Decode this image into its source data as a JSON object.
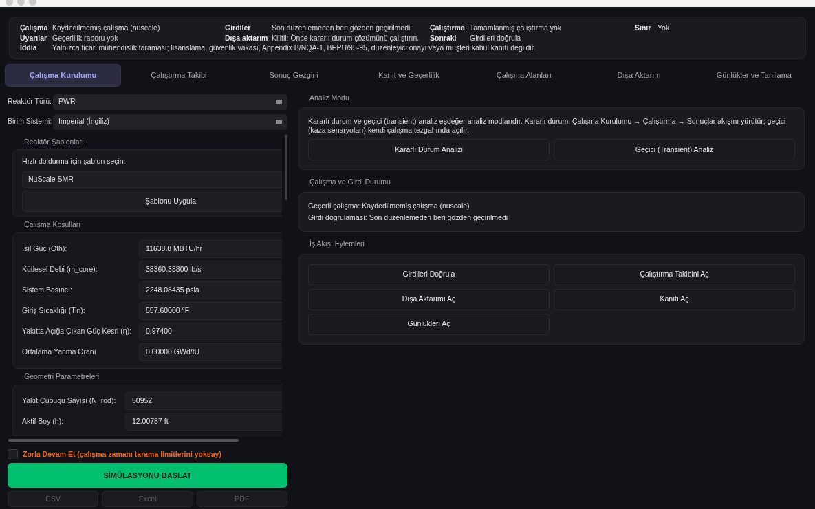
{
  "status": {
    "rows": [
      [
        {
          "label": "Çalışma",
          "value": "Kaydedilmemiş çalışma (nuscale)"
        },
        {
          "label": "Girdiler",
          "value": "Son düzenlemeden beri gözden geçirilmedi"
        },
        {
          "label": "Çalıştırma",
          "value": "Tamamlanmış çalıştırma yok"
        },
        {
          "label": "Sınır",
          "value": "Yok"
        }
      ],
      [
        {
          "label": "Uyarılar",
          "value": "Geçerlilik raporu yok"
        },
        {
          "label": "Dışa aktarım",
          "value": "Kilitli: Önce kararlı durum çözümünü çalıştırın."
        },
        {
          "label": "Sonraki",
          "value": "Girdileri doğrula"
        }
      ],
      [
        {
          "label": "İddia",
          "value": "Yalnızca ticari mühendislik taraması; lisanslama, güvenlik vakası, Appendix B/NQA-1, BEPU/95-95, düzenleyici onayı veya müşteri kabul kanıtı değildir."
        }
      ]
    ]
  },
  "tabs": [
    {
      "label": "Çalışma Kurulumu",
      "selected": true
    },
    {
      "label": "Çalıştırma Takibi",
      "selected": false
    },
    {
      "label": "Sonuç Gezgini",
      "selected": false
    },
    {
      "label": "Kanıt ve Geçerlilik",
      "selected": false
    },
    {
      "label": "Çalışma Alanları",
      "selected": false
    },
    {
      "label": "Dışa Aktarım",
      "selected": false
    },
    {
      "label": "Günlükler ve Tanılama",
      "selected": false
    }
  ],
  "setup": {
    "selects": [
      {
        "label": "Reaktör Türü:",
        "value": "PWR"
      },
      {
        "label": "Birim Sistemi:",
        "value": "Imperial (İngiliz)"
      }
    ],
    "templates": {
      "title": "Reaktör Şablonları",
      "prompt": "Hızlı doldurma için şablon seçin:",
      "value": "NuScale SMR",
      "button": "Şablonu Uygula"
    },
    "groups": [
      {
        "title": "Çalışma Koşulları",
        "fields": [
          {
            "label": "Isıl Güç (Qth):",
            "value": "11638.8 MBTU/hr"
          },
          {
            "label": "Kütlesel Debi (m_core):",
            "value": "38360.38800 lb/s"
          },
          {
            "label": "Sistem Basıncı:",
            "value": "2248.08435 psia"
          },
          {
            "label": "Giriş Sıcaklığı (Tin):",
            "value": "557.60000 °F"
          },
          {
            "label": "Yakıtta Açığa Çıkan Güç Kesri (η):",
            "value": "0.97400"
          },
          {
            "label": "Ortalama Yanma Oranı",
            "value": "0.00000 GWd/tU"
          }
        ]
      },
      {
        "title": "Geometri Parametreleri",
        "fields": [
          {
            "label": "Yakıt Çubuğu Sayısı (N_rod):",
            "value": "50952"
          },
          {
            "label": "Aktif Boy (h):",
            "value": "12.00787 ft"
          }
        ]
      }
    ]
  },
  "force_continue": {
    "label": "Zorla Devam Et (çalışma zamanı tarama limitlerini yoksay)",
    "checked": false
  },
  "start_button": "SİMÜLASYONU BAŞLAT",
  "export_buttons": [
    {
      "label": "CSV",
      "disabled": true
    },
    {
      "label": "Excel",
      "disabled": true
    },
    {
      "label": "PDF",
      "disabled": true
    }
  ],
  "analysis_mode": {
    "title": "Analiz Modu",
    "description": "Kararlı durum ve geçici (transient) analiz eşdeğer analiz modlarıdır. Kararlı durum, Çalışma Kurulumu → Çalıştırma → Sonuçlar akışını yürütür; geçici (kaza senaryoları) kendi çalışma tezgahında açılır.",
    "buttons": [
      "Kararlı Durum Analizi",
      "Geçici (Transient) Analiz"
    ]
  },
  "run_status": {
    "title": "Çalışma ve Girdi Durumu",
    "lines": [
      "Geçerli çalışma: Kaydedilmemiş çalışma (nuscale)",
      "Girdi doğrulaması: Son düzenlemeden beri gözden geçirilmedi"
    ]
  },
  "workflow": {
    "title": "İş Akışı Eylemleri",
    "buttons": [
      "Girdileri Doğrula",
      "Çalıştırma Takibini Aç",
      "Dışa Aktarımı Aç",
      "Kanıtı Aç",
      "Günlükleri Aç"
    ]
  }
}
